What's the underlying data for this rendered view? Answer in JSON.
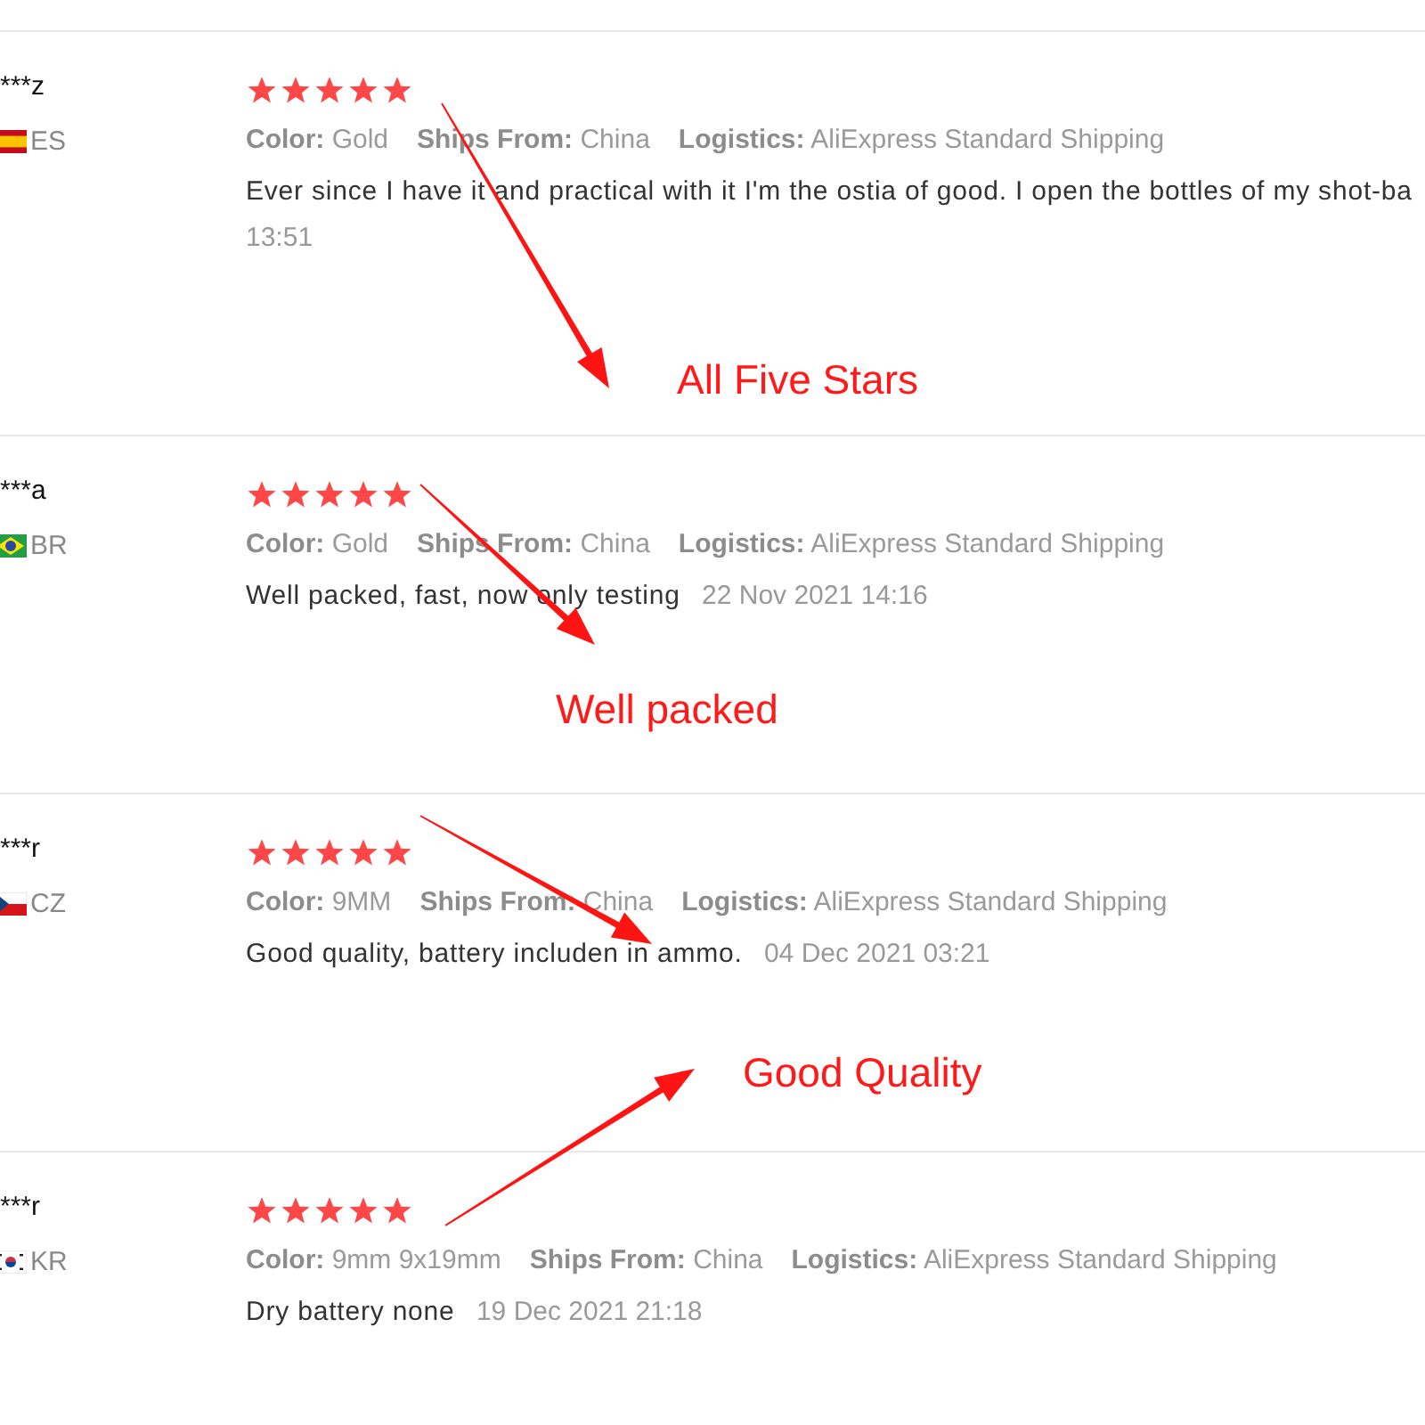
{
  "reviews": [
    {
      "user": "***z",
      "kind": "es",
      "country": "ES",
      "stars": 5,
      "details": [
        {
          "label": "Color:",
          "value": "Gold"
        },
        {
          "label": "Ships From:",
          "value": "China"
        },
        {
          "label": "Logistics:",
          "value": "AliExpress Standard Shipping"
        }
      ],
      "text": "Ever since I have it and practical with it I'm the ostia of good. I open the bottles of my shot-ba",
      "date": "13:51"
    },
    {
      "user": "***a",
      "kind": "br",
      "country": "BR",
      "stars": 5,
      "details": [
        {
          "label": "Color:",
          "value": "Gold"
        },
        {
          "label": "Ships From:",
          "value": "China"
        },
        {
          "label": "Logistics:",
          "value": "AliExpress Standard Shipping"
        }
      ],
      "text": "Well packed, fast, now only testing",
      "date": "22 Nov 2021 14:16"
    },
    {
      "user": "***r",
      "kind": "cz",
      "country": "CZ",
      "stars": 5,
      "details": [
        {
          "label": "Color:",
          "value": "9MM"
        },
        {
          "label": "Ships From:",
          "value": "China"
        },
        {
          "label": "Logistics:",
          "value": "AliExpress Standard Shipping"
        }
      ],
      "text": "Good quality, battery includen in ammo.",
      "date": "04 Dec 2021 03:21"
    },
    {
      "user": "***r",
      "kind": "kr",
      "country": "KR",
      "stars": 5,
      "details": [
        {
          "label": "Color:",
          "value": "9mm 9x19mm"
        },
        {
          "label": "Ships From:",
          "value": "China"
        },
        {
          "label": "Logistics:",
          "value": "AliExpress Standard Shipping"
        }
      ],
      "text": "Dry battery none",
      "date": "19 Dec 2021 21:18"
    }
  ],
  "annotations": [
    {
      "text": "All Five Stars"
    },
    {
      "text": "Well packed"
    },
    {
      "text": "Good Quality"
    }
  ]
}
